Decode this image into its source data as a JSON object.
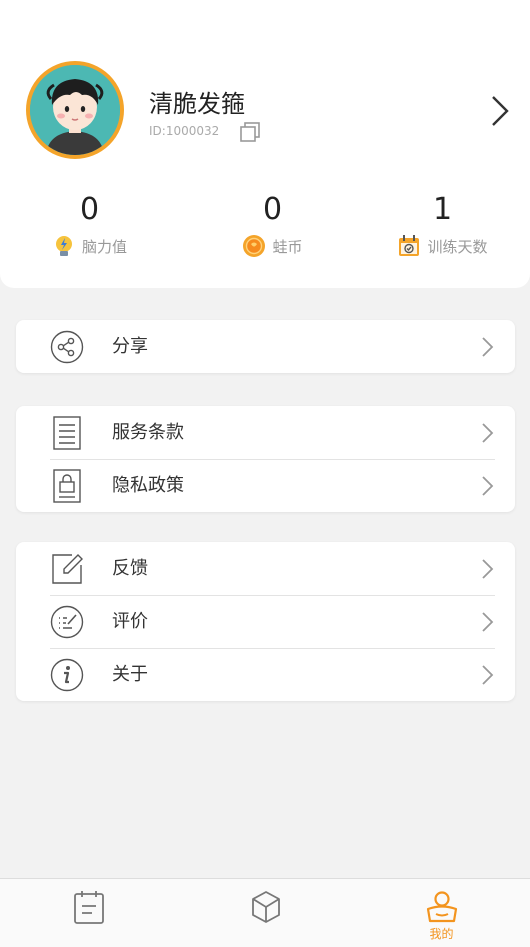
{
  "profile": {
    "username": "清脆发箍",
    "user_id": "ID:1000032"
  },
  "stats": [
    {
      "value": "0",
      "label": "脑力值",
      "icon": "lightbulb-icon"
    },
    {
      "value": "0",
      "label": "蛙币",
      "icon": "coin-icon"
    },
    {
      "value": "1",
      "label": "训练天数",
      "icon": "calendar-icon"
    }
  ],
  "menu": {
    "share": "分享",
    "terms": "服务条款",
    "privacy": "隐私政策",
    "feedback": "反馈",
    "rate": "评价",
    "about": "关于"
  },
  "tabbar": {
    "tabs": [
      {
        "icon": "clipboard-icon",
        "label": ""
      },
      {
        "icon": "cube-icon",
        "label": ""
      },
      {
        "icon": "user-icon",
        "label": "我的"
      }
    ],
    "active_color": "#f3941e"
  },
  "colors": {
    "accent": "#f4a42a",
    "avatar_bg": "#4cb8b3"
  }
}
